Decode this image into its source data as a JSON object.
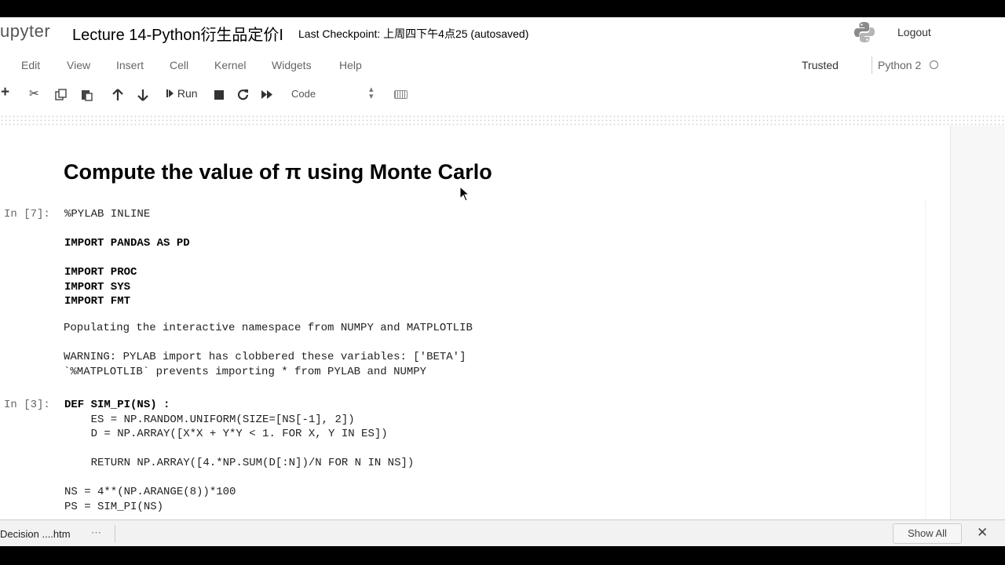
{
  "header": {
    "logo_text": "upyter",
    "notebook_name": "Lecture 14-Python衍生品定价I",
    "checkpoint": "Last Checkpoint: 上周四下午4点25  (autosaved)",
    "logout": "Logout"
  },
  "menu": {
    "items": [
      "Edit",
      "View",
      "Insert",
      "Cell",
      "Kernel",
      "Widgets",
      "Help"
    ],
    "trusted": "Trusted",
    "kernel": "Python 2"
  },
  "toolbar": {
    "run_label": "Run",
    "cell_type": "Code"
  },
  "notebook": {
    "heading": "Compute the value of π using Monte Carlo",
    "cells": [
      {
        "prompt": "In [7]:",
        "lines": [
          "%PYLAB INLINE",
          "",
          "IMPORT PANDAS AS PD",
          "",
          "IMPORT PROC",
          "IMPORT SYS",
          "IMPORT FMT"
        ],
        "output": [
          "Populating the interactive namespace from NUMPY and MATPLOTLIB",
          "",
          "WARNING: PYLAB import has clobbered these variables: ['BETA']",
          "`%MATPLOTLIB` prevents importing * from PYLAB and NUMPY"
        ]
      },
      {
        "prompt": "In [3]:",
        "lines": [
          "DEF SIM_PI(NS) :",
          "    ES = NP.RANDOM.UNIFORM(SIZE=[NS[-1], 2])",
          "    D = NP.ARRAY([X*X + Y*Y < 1. FOR X, Y IN ES])",
          "",
          "    RETURN NP.ARRAY([4.*NP.SUM(D[:N])/N FOR N IN NS])",
          "",
          "NS = 4**(NP.ARANGE(8))*100",
          "PS = SIM_PI(NS)"
        ]
      }
    ]
  },
  "downloads": {
    "file": "Decision ....htm",
    "show_all": "Show All"
  }
}
